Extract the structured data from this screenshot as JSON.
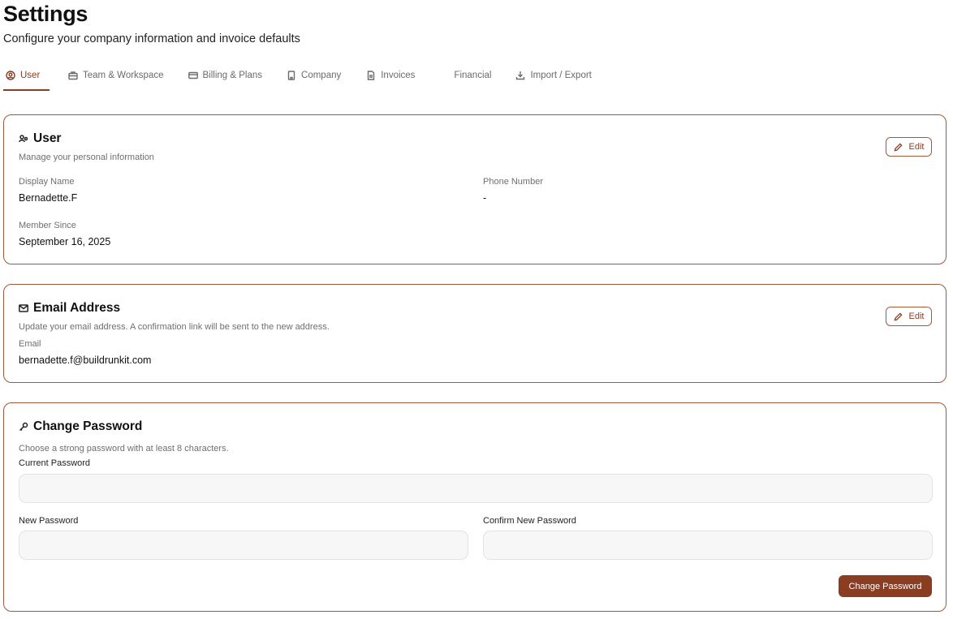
{
  "header": {
    "title": "Settings",
    "subtitle": "Configure your company information and invoice defaults"
  },
  "tabs": [
    {
      "label": "User",
      "icon": "user-circle-icon",
      "active": true
    },
    {
      "label": "Team & Workspace",
      "icon": "briefcase-icon",
      "active": false
    },
    {
      "label": "Billing & Plans",
      "icon": "credit-card-icon",
      "active": false
    },
    {
      "label": "Company",
      "icon": "building-icon",
      "active": false
    },
    {
      "label": "Invoices",
      "icon": "document-icon",
      "active": false
    },
    {
      "label": "Financial",
      "icon": "",
      "active": false
    },
    {
      "label": "Import / Export",
      "icon": "download-icon",
      "active": false
    }
  ],
  "user_card": {
    "title": "User",
    "description": "Manage your personal information",
    "edit_label": "Edit",
    "display_name_label": "Display Name",
    "display_name": "Bernadette.F",
    "phone_label": "Phone Number",
    "phone": "-",
    "member_since_label": "Member Since",
    "member_since": "September 16, 2025"
  },
  "email_card": {
    "title": "Email Address",
    "description": "Update your email address. A confirmation link will be sent to the new address.",
    "edit_label": "Edit",
    "email_label": "Email",
    "email": "bernadette.f@buildrunkit.com"
  },
  "password_card": {
    "title": "Change Password",
    "description": "Choose a strong password with at least 8 characters.",
    "current_label": "Current Password",
    "current_value": "",
    "new_label": "New Password",
    "new_value": "",
    "confirm_label": "Confirm New Password",
    "confirm_value": "",
    "submit_label": "Change Password"
  },
  "colors": {
    "accent": "#8b3d22",
    "border": "#a0583a"
  }
}
